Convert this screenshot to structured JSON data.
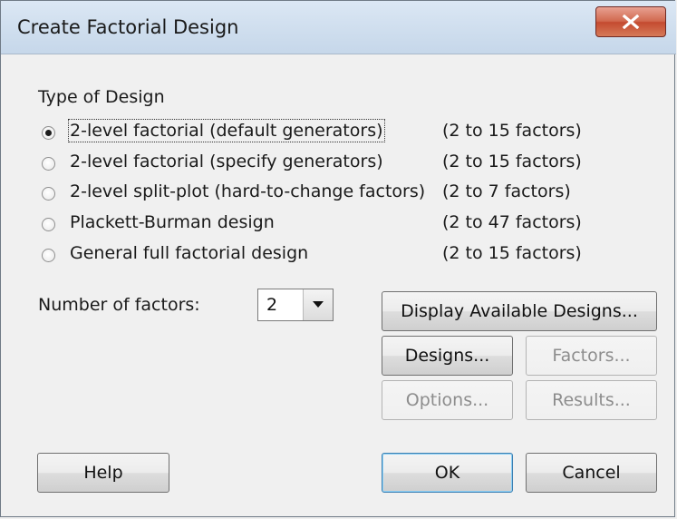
{
  "window": {
    "title": "Create Factorial Design",
    "close_label": "X"
  },
  "type_of_design": {
    "heading": "Type of Design",
    "options": [
      {
        "label": "2-level factorial (default generators)",
        "range": "(2 to 15 factors)",
        "selected": true
      },
      {
        "label": "2-level factorial (specify generators)",
        "range": "(2 to 15 factors)",
        "selected": false
      },
      {
        "label": "2-level split-plot (hard-to-change factors)",
        "range": "(2 to 7 factors)",
        "selected": false
      },
      {
        "label": "Plackett-Burman design",
        "range": "(2 to 47 factors)",
        "selected": false
      },
      {
        "label": "General full factorial design",
        "range": "(2 to 15 factors)",
        "selected": false
      }
    ]
  },
  "number_of_factors": {
    "label": "Number of factors:",
    "value": "2"
  },
  "buttons": {
    "display_available": "Display Available Designs...",
    "designs": "Designs...",
    "factors": "Factors...",
    "options": "Options...",
    "results": "Results...",
    "help": "Help",
    "ok": "OK",
    "cancel": "Cancel"
  },
  "colors": {
    "close_button": "#c44a30",
    "dialog_bg": "#f0f0f0",
    "titlebar": "#cfdeee"
  }
}
